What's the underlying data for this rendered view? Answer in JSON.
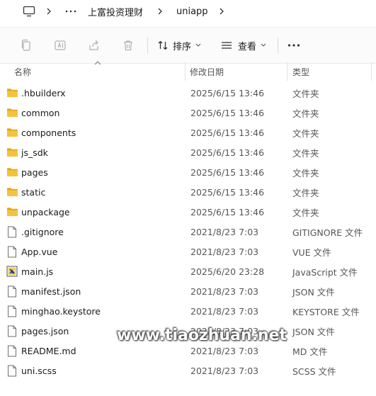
{
  "breadcrumb": {
    "items": [
      "上富投资理财",
      "uniapp"
    ]
  },
  "toolbar": {
    "sort_label": "排序",
    "view_label": "查看"
  },
  "columns": {
    "name": "名称",
    "date": "修改日期",
    "type": "类型"
  },
  "files": [
    {
      "name": ".hbuilderx",
      "date": "2025/6/15 13:46",
      "type": "文件夹",
      "icon": "folder"
    },
    {
      "name": "common",
      "date": "2025/6/15 13:46",
      "type": "文件夹",
      "icon": "folder"
    },
    {
      "name": "components",
      "date": "2025/6/15 13:46",
      "type": "文件夹",
      "icon": "folder"
    },
    {
      "name": "js_sdk",
      "date": "2025/6/15 13:46",
      "type": "文件夹",
      "icon": "folder"
    },
    {
      "name": "pages",
      "date": "2025/6/15 13:46",
      "type": "文件夹",
      "icon": "folder"
    },
    {
      "name": "static",
      "date": "2025/6/15 13:46",
      "type": "文件夹",
      "icon": "folder"
    },
    {
      "name": "unpackage",
      "date": "2025/6/15 13:46",
      "type": "文件夹",
      "icon": "folder"
    },
    {
      "name": ".gitignore",
      "date": "2021/8/23 7:03",
      "type": "GITIGNORE 文件",
      "icon": "file"
    },
    {
      "name": "App.vue",
      "date": "2021/8/23 7:03",
      "type": "VUE 文件",
      "icon": "file"
    },
    {
      "name": "main.js",
      "date": "2025/6/20 23:28",
      "type": "JavaScript 文件",
      "icon": "script"
    },
    {
      "name": "manifest.json",
      "date": "2021/8/23 7:03",
      "type": "JSON 文件",
      "icon": "file"
    },
    {
      "name": "minghao.keystore",
      "date": "2021/8/23 7:03",
      "type": "KEYSTORE 文件",
      "icon": "file"
    },
    {
      "name": "pages.json",
      "date": "2021/8/23 7:03",
      "type": "JSON 文件",
      "icon": "file"
    },
    {
      "name": "README.md",
      "date": "2021/8/23 7:03",
      "type": "MD 文件",
      "icon": "file"
    },
    {
      "name": "uni.scss",
      "date": "2021/8/23 7:03",
      "type": "SCSS 文件",
      "icon": "file"
    }
  ],
  "watermark": "www.tiaozhuan.net",
  "colors": {
    "folder": "#f4c33e",
    "folder_dark": "#e3a81c",
    "icon_gray": "#b0b0b0",
    "text": "#1a1a1a",
    "secondary": "#555555"
  }
}
